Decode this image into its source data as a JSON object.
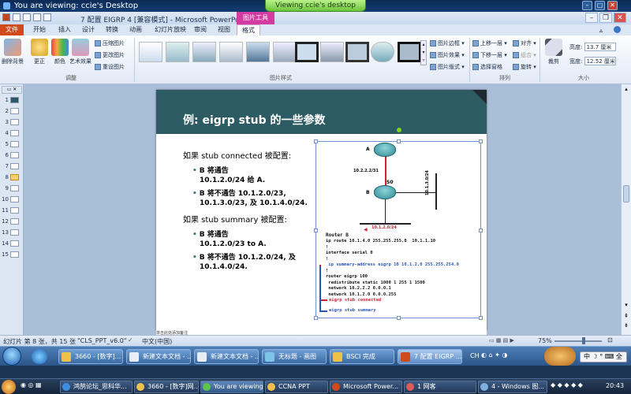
{
  "remote_bar": {
    "title": "You are viewing: ccie's Desktop",
    "center_tab": "Viewing ccie's desktop"
  },
  "ppt_window": {
    "title": "7 配置 EIGRP 4 [兼容模式] - Microsoft PowerPoint",
    "picture_tools_label": "图片工具"
  },
  "ribbon_tabs": [
    "文件",
    "开始",
    "插入",
    "设计",
    "转换",
    "动画",
    "幻灯片放映",
    "审阅",
    "视图",
    "格式"
  ],
  "ribbon": {
    "adjust": {
      "remove_bg": "删除背景",
      "corrections": "更正",
      "color": "颜色",
      "artistic": "艺术效果",
      "compress": "压缩图片",
      "change": "更改图片",
      "reset": "重设图片",
      "group_label": "调整"
    },
    "styles_label": "图片样式",
    "picture_border": "图片边框",
    "picture_effects": "图片效果",
    "picture_layout": "图片版式",
    "arrange": {
      "bring_forward": "上移一层",
      "send_backward": "下移一层",
      "selection_pane": "选择窗格",
      "align": "对齐",
      "group": "组合",
      "rotate": "旋转",
      "group_label": "排列"
    },
    "size": {
      "crop": "裁剪",
      "height_label": "高度:",
      "height_value": "13.7 厘米",
      "width_label": "宽度:",
      "width_value": "12.52 厘米",
      "group_label": "大小"
    }
  },
  "thumbnails": [
    "1",
    "2",
    "3",
    "4",
    "5",
    "6",
    "7",
    "8",
    "9",
    "10",
    "11",
    "12",
    "13",
    "14",
    "15"
  ],
  "selected_slide": "8",
  "slide": {
    "title": "例: eigrp stub 的一些参数",
    "connected_heading": "如果 stub connected 被配置:",
    "connected_b1_l1": "B 将通告",
    "connected_b1_l2": "10.1.2.0/24    给 A.",
    "connected_b2_l1": "B 将不通告 10.1.2.0/23,",
    "connected_b2_l2": "10.1.3.0/23, 及 10.1.4.0/24.",
    "summary_heading": "如果 stub summary 被配置:",
    "summary_b1_l1": "B 将通告",
    "summary_b1_l2": "10.1.2.0/23 to A.",
    "summary_b2_l1": "B 将不通告 10.1.2.0/24, 及",
    "summary_b2_l2": "10.1.4.0/24."
  },
  "diagram": {
    "router_a": "A",
    "router_b": "B",
    "link_label": "10.2.2.2/31",
    "s0": "S0",
    "lan_right": "10.1.3.0/24",
    "lan_bottom": "10.1.2.0/24",
    "config_title": "Router B",
    "config_lines": [
      "ip route 10.1.4.0 255.255.255.0  10.1.1.10",
      "!",
      "interface serial 0",
      "!",
      " ip summary-address eigrp 10 10.1.2.0 255.255.254.0",
      "!",
      "router eigrp 100",
      " redistribute static 1000 1 255 1 1500",
      " network 10.2.2.2 0.0.0.1",
      " network 10.1.2.0 0.0.0.255"
    ],
    "stub_connected": "eigrp stub connected",
    "stub_summary": "eigrp stub summary"
  },
  "notes_text": "单击此处添加备注",
  "status": {
    "slide_info": "幻灯片 第 8 张，共 15 张",
    "theme": "\"CLS_PPT_v6.0\"",
    "language": "中文(中国)",
    "zoom": "75%"
  },
  "remote_taskbar": [
    {
      "label": "3660 - [数字]..."
    },
    {
      "label": "新建文本文档 - ..."
    },
    {
      "label": "新建文本文档 - ..."
    },
    {
      "label": "无标题 - 画图"
    },
    {
      "label": "BSCI 完成"
    },
    {
      "label": "7 配置 EIGRP ..."
    }
  ],
  "remote_tray": {
    "ime": "CH",
    "ime_label": "中"
  },
  "local_taskbar": [
    {
      "label": "鸿鹄论坛_思科华..."
    },
    {
      "label": "3660 - [数字]网..."
    },
    {
      "label": "You are viewing:..."
    },
    {
      "label": "CCNA PPT"
    },
    {
      "label": "Microsoft Power..."
    },
    {
      "label": "1 网客"
    },
    {
      "label": "4 - Windows 图..."
    }
  ],
  "local_tray": {
    "time": "20:43"
  }
}
